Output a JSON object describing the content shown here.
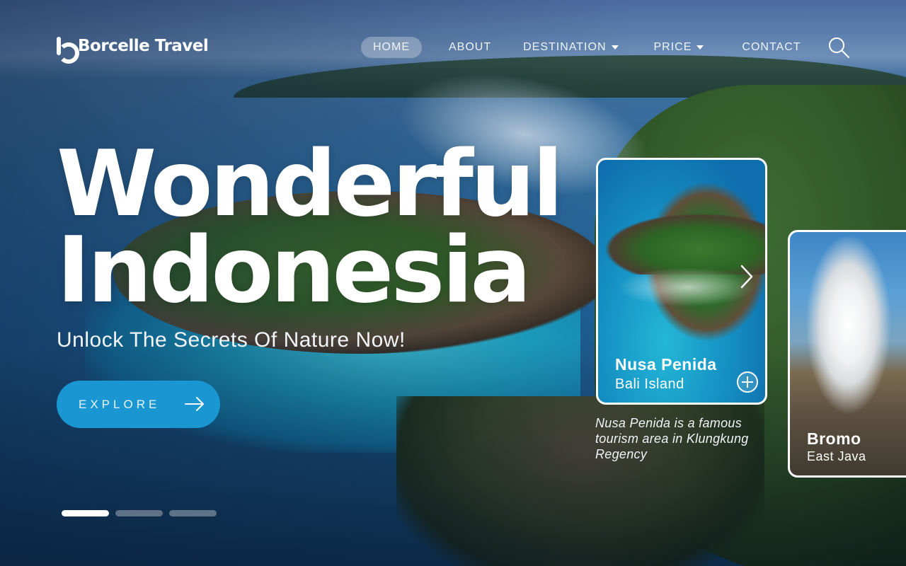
{
  "brand": {
    "name": "Borcelle Travel"
  },
  "nav": {
    "items": [
      {
        "label": "HOME",
        "active": true
      },
      {
        "label": "ABOUT"
      },
      {
        "label": "DESTINATION",
        "dropdown": true
      },
      {
        "label": "PRICE",
        "dropdown": true
      },
      {
        "label": "CONTACT"
      }
    ],
    "search_icon": "search-icon"
  },
  "hero": {
    "title_line1": "Wonderful",
    "title_line2": "Indonesia",
    "subtitle": "Unlock The Secrets Of Nature Now!",
    "cta_label": "EXPLORE",
    "cta_icon": "arrow-right-icon",
    "slides_total": 3,
    "slide_active": 1
  },
  "cards": [
    {
      "title": "Nusa Penida",
      "location": "Bali Island",
      "description": "Nusa Penida is a famous tourism area in Klungkung Regency",
      "action_icon": "plus-icon",
      "nav_icon": "chevron-right-icon"
    },
    {
      "title": "Bromo",
      "location": "East Java"
    }
  ],
  "colors": {
    "accent": "#1a97d2",
    "text": "#ffffff"
  }
}
